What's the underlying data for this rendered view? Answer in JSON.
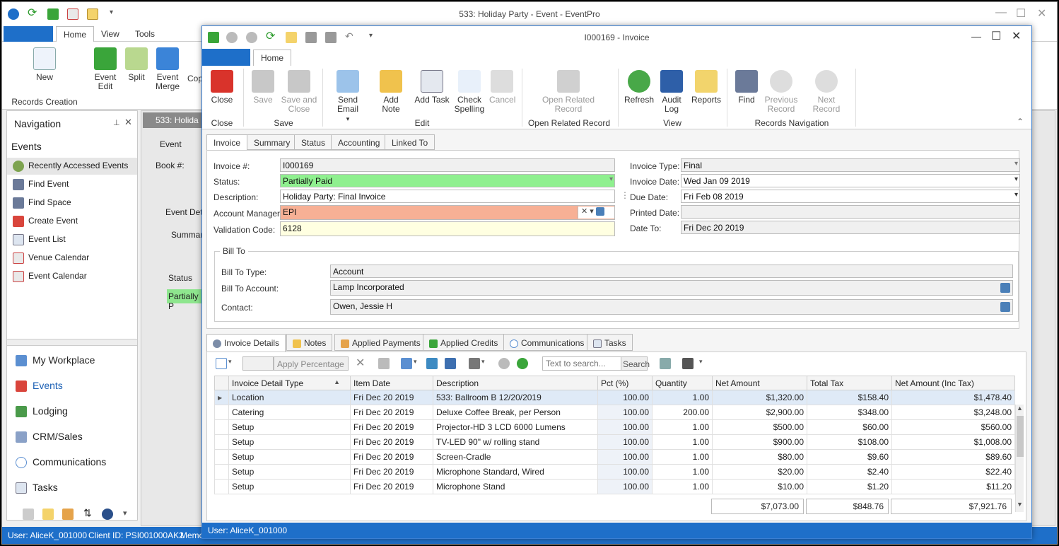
{
  "main": {
    "title": "533: Holiday Party - Event - EventPro",
    "ribbon_tabs": [
      "Home",
      "View",
      "Tools"
    ],
    "ribbon_buttons": [
      "New",
      "Event Edit",
      "Split",
      "Event Merge",
      "Cop"
    ],
    "group_records_creation": "Records Creation"
  },
  "nav": {
    "title": "Navigation",
    "section": "Events",
    "items": [
      "Recently Accessed Events",
      "Find Event",
      "Find Space",
      "Create Event",
      "Event List",
      "Venue Calendar",
      "Event Calendar"
    ],
    "big_items": [
      "My Workplace",
      "Events",
      "Lodging",
      "CRM/Sales",
      "Communications",
      "Tasks"
    ]
  },
  "event_bg": {
    "tab": "533: Holida",
    "event_label": "Event",
    "book_label": "Book #:",
    "event_detail": "Event Deta",
    "summary": "Summary",
    "status_header": "Status",
    "status_value": "Partially P"
  },
  "statusbar": {
    "user": "User: AliceK_001000",
    "client": "Client ID: PSI001000AK2",
    "memory": "Memor"
  },
  "invoice": {
    "title": "I000169 - Invoice",
    "ribbon_tab": "Home",
    "buttons": {
      "close": "Close",
      "save": "Save",
      "save_close_1": "Save and",
      "save_close_2": "Close",
      "send_email": "Send Email",
      "add_note": "Add Note",
      "add_task": "Add Task",
      "check_1": "Check",
      "check_2": "Spelling",
      "cancel": "Cancel",
      "open_rel_1": "Open Related",
      "open_rel_2": "Record",
      "refresh": "Refresh",
      "audit_1": "Audit",
      "audit_2": "Log",
      "reports": "Reports",
      "find": "Find",
      "prev_1": "Previous",
      "prev_2": "Record",
      "next": "Next Record"
    },
    "groups": {
      "close": "Close",
      "save": "Save",
      "edit": "Edit",
      "open_related": "Open Related Record",
      "view": "View",
      "nav": "Records Navigation"
    },
    "form_tabs": [
      "Invoice",
      "Summary",
      "Status",
      "Accounting",
      "Linked To"
    ],
    "labels": {
      "invoice_no": "Invoice #:",
      "status": "Status:",
      "description": "Description:",
      "account_manager": "Account Manager:",
      "validation": "Validation Code:",
      "invoice_type": "Invoice Type:",
      "invoice_date": "Invoice Date:",
      "due_date": "Due Date:",
      "printed_date": "Printed Date:",
      "date_to": "Date To:",
      "bill_to": "Bill To",
      "bill_to_type": "Bill To Type:",
      "bill_to_account": "Bill To Account:",
      "contact": "Contact:"
    },
    "values": {
      "invoice_no": "I000169",
      "status": "Partially Paid",
      "description": "Holiday Party: Final Invoice",
      "account_manager": "EPI",
      "validation": "6128",
      "invoice_type": "Final",
      "invoice_date": "Wed Jan 09 2019",
      "due_date": "Fri Feb 08 2019",
      "printed_date": "",
      "date_to": "Fri Dec 20 2019",
      "bill_to_type": "Account",
      "bill_to_account": "Lamp Incorporated",
      "contact": "Owen, Jessie H"
    },
    "detail_tabs": [
      "Invoice Details",
      "Notes",
      "Applied Payments",
      "Applied Credits",
      "Communications",
      "Tasks"
    ],
    "toolbar": {
      "apply_percentage": "Apply Percentage",
      "search_placeholder": "Text to search...",
      "search_button": "Search"
    },
    "columns": [
      "Invoice Detail Type",
      "Item Date",
      "Description",
      "Pct (%)",
      "Quantity",
      "Net Amount",
      "Total Tax",
      "Net Amount (Inc Tax)"
    ],
    "rows": [
      [
        "Location",
        "Fri Dec 20 2019",
        "533: Ballroom B 12/20/2019",
        "100.00",
        "1.00",
        "$1,320.00",
        "$158.40",
        "$1,478.40"
      ],
      [
        "Catering",
        "Fri Dec 20 2019",
        "Deluxe Coffee Break, per Person",
        "100.00",
        "200.00",
        "$2,900.00",
        "$348.00",
        "$3,248.00"
      ],
      [
        "Setup",
        "Fri Dec 20 2019",
        "Projector-HD 3 LCD 6000 Lumens",
        "100.00",
        "1.00",
        "$500.00",
        "$60.00",
        "$560.00"
      ],
      [
        "Setup",
        "Fri Dec 20 2019",
        "TV-LED 90\" w/ rolling stand",
        "100.00",
        "1.00",
        "$900.00",
        "$108.00",
        "$1,008.00"
      ],
      [
        "Setup",
        "Fri Dec 20 2019",
        "Screen-Cradle",
        "100.00",
        "1.00",
        "$80.00",
        "$9.60",
        "$89.60"
      ],
      [
        "Setup",
        "Fri Dec 20 2019",
        "Microphone Standard, Wired",
        "100.00",
        "1.00",
        "$20.00",
        "$2.40",
        "$22.40"
      ],
      [
        "Setup",
        "Fri Dec 20 2019",
        "Microphone Stand",
        "100.00",
        "1.00",
        "$10.00",
        "$1.20",
        "$11.20"
      ]
    ],
    "totals": {
      "net": "$7,073.00",
      "tax": "$848.76",
      "inc_tax": "$7,921.76"
    },
    "status_user": "User: AliceK_001000"
  }
}
